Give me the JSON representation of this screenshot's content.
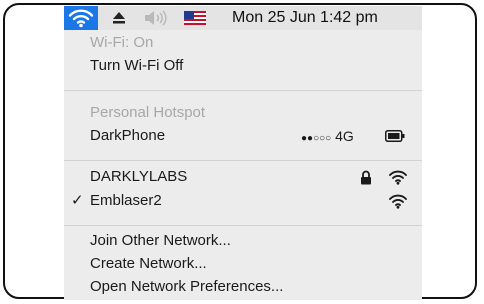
{
  "menubar": {
    "clock": "Mon 25 Jun  1:42 pm",
    "icons": [
      "wifi-icon",
      "eject-icon",
      "volume-icon",
      "flag-icon"
    ]
  },
  "menu": {
    "wifi_status": "Wi-Fi: On",
    "turn_off": "Turn Wi-Fi Off",
    "hotspot_header": "Personal Hotspot",
    "hotspot_name": "DarkPhone",
    "hotspot_signal": "●●○○○",
    "hotspot_network": "4G",
    "networks": [
      {
        "name": "DARKLYLABS",
        "locked": true,
        "checked": false
      },
      {
        "name": "Emblaser2",
        "locked": false,
        "checked": true
      }
    ],
    "checkmark": "✓",
    "actions": [
      "Join Other Network...",
      "Create Network...",
      "Open Network Preferences..."
    ]
  },
  "colors": {
    "accent": "#1b76e8",
    "menu_bg": "#ececec",
    "menubar_bg": "#e4e4e4"
  }
}
